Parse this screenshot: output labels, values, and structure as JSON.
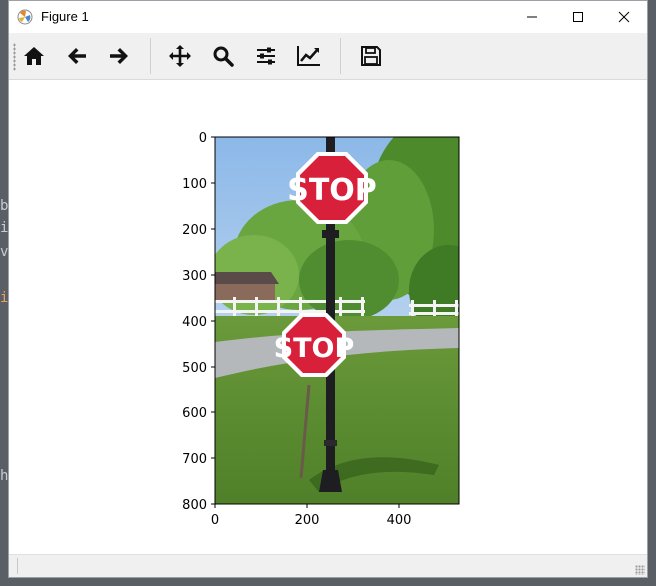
{
  "window": {
    "title": "Figure 1"
  },
  "toolbar": {
    "tools": [
      {
        "name": "home",
        "icon": "home-icon"
      },
      {
        "name": "back",
        "icon": "arrow-left-icon"
      },
      {
        "name": "forward",
        "icon": "arrow-right-icon"
      },
      {
        "name": "pan",
        "icon": "move-icon"
      },
      {
        "name": "zoom",
        "icon": "zoom-icon"
      },
      {
        "name": "subplots",
        "icon": "sliders-icon"
      },
      {
        "name": "edit-axes",
        "icon": "chart-line-icon"
      },
      {
        "name": "save",
        "icon": "save-icon"
      }
    ]
  },
  "figure": {
    "image": {
      "sign_top_text": "STOP",
      "sign_bottom_text": "STOP"
    },
    "xaxis": {
      "ticks": [
        "0",
        "200",
        "400"
      ]
    },
    "yaxis": {
      "ticks": [
        "0",
        "100",
        "200",
        "300",
        "400",
        "500",
        "600",
        "700",
        "800"
      ]
    }
  },
  "colors": {
    "stop_red": "#d8203a",
    "axes_frame": "#000000",
    "toolbar_bg": "#f0f0f0"
  }
}
